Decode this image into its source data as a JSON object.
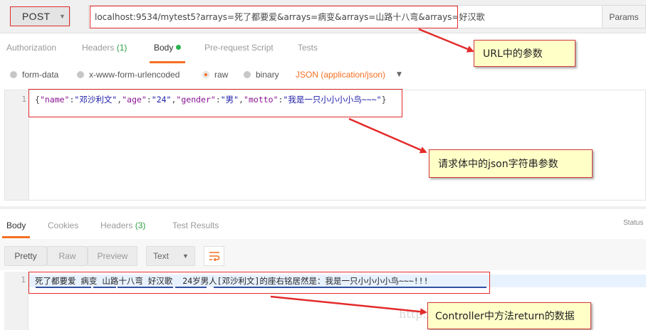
{
  "request": {
    "method": "POST",
    "url": "localhost:9534/mytest5?arrays=死了都要爱&arrays=病变&arrays=山路十八弯&arrays=好汉歌",
    "params_label": "Params"
  },
  "request_tabs": [
    {
      "label": "Authorization"
    },
    {
      "label": "Headers",
      "count": "(1)"
    },
    {
      "label": "Body"
    },
    {
      "label": "Pre-request Script"
    },
    {
      "label": "Tests"
    }
  ],
  "body_options": {
    "form_data": "form-data",
    "urlencoded": "x-www-form-urlencoded",
    "raw": "raw",
    "binary": "binary",
    "content_type": "JSON (application/json)"
  },
  "request_body": {
    "line_number": "1",
    "open": "{",
    "name_key": "\"name\"",
    "name_val": "\"邓沙利文\"",
    "age_key": "\"age\"",
    "age_val": "\"24\"",
    "gender_key": "\"gender\"",
    "gender_val": "\"男\"",
    "motto_key": "\"motto\"",
    "motto_val": "\"我是一只小小小小鸟~~~\"",
    "close": "}"
  },
  "response_tabs": [
    {
      "label": "Body"
    },
    {
      "label": "Cookies"
    },
    {
      "label": "Headers",
      "count": "(3)"
    },
    {
      "label": "Test Results"
    }
  ],
  "status_label": "Status",
  "response_toolbar": {
    "pretty": "Pretty",
    "raw": "Raw",
    "preview": "Preview",
    "text": "Text"
  },
  "response_body": {
    "line_number": "1",
    "part1": "死了都要爱  病变  山路十八弯  好汉歌",
    "part2": "24岁男人[邓沙利文]的座右铭居然是：我是一只小小小小鸟~~~!!!"
  },
  "annotations": {
    "url": "URL中的参数",
    "json": "请求体中的json字符串参数",
    "return": "Controller中方法return的数据"
  },
  "watermark": "http://blog.csdn.net/try_deng",
  "colors": {
    "accent": "#f47023",
    "annotation_red": "#e32b2b",
    "callout_bg": "#ffffc8"
  }
}
